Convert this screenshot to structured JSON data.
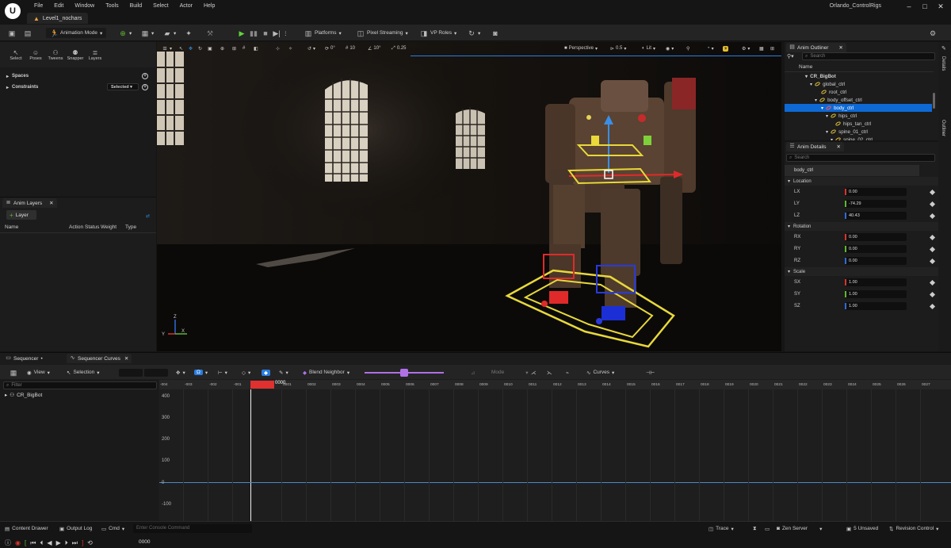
{
  "menu": [
    "File",
    "Edit",
    "Window",
    "Tools",
    "Build",
    "Select",
    "Actor",
    "Help"
  ],
  "level_tab": "Level1_nochars",
  "project_name": "Orlando_ControlRigs",
  "toolbar": {
    "mode": "Animation Mode",
    "platforms": "Platforms",
    "pixel_streaming": "Pixel Streaming",
    "vp_roles": "VP Roles"
  },
  "left_panel": {
    "modes": [
      "Select",
      "Poses",
      "Tweens",
      "Snapper",
      "Layers"
    ],
    "spaces": "Spaces",
    "constraints": "Constraints",
    "constraints_filter": "Selected"
  },
  "anim_layers": {
    "tab": "Anim Layers",
    "add_button": "Layer",
    "columns": [
      "Name",
      "Action",
      "Status",
      "Weight",
      "Type"
    ]
  },
  "viewport": {
    "perspective": "Perspective",
    "lit": "Lit",
    "transform_values": [
      "0°",
      "10",
      "10°",
      "0.25"
    ],
    "cam_speed": "0.5"
  },
  "outliner": {
    "tab": "Anim Outliner",
    "search_placeholder": "Search",
    "column": "Name",
    "items": [
      {
        "label": "CR_BigBot",
        "indent": 0,
        "selected": false
      },
      {
        "label": "global_ctrl",
        "indent": 1,
        "selected": false
      },
      {
        "label": "root_ctrl",
        "indent": 2,
        "selected": false
      },
      {
        "label": "body_offset_ctrl",
        "indent": 2,
        "selected": false
      },
      {
        "label": "body_ctrl",
        "indent": 3,
        "selected": true
      },
      {
        "label": "hips_ctrl",
        "indent": 4,
        "selected": false
      },
      {
        "label": "hips_tan_ctrl",
        "indent": 5,
        "selected": false
      },
      {
        "label": "spine_01_ctrl",
        "indent": 4,
        "selected": false
      },
      {
        "label": "spine_02_ctrl",
        "indent": 4,
        "selected": false
      }
    ]
  },
  "details": {
    "tab": "Anim Details",
    "search_placeholder": "Search",
    "selected_control": "body_ctrl",
    "sections": [
      {
        "name": "Location",
        "rows": [
          {
            "label": "LX",
            "value": "0.00",
            "color": "#d9342b"
          },
          {
            "label": "LY",
            "value": "-74.29",
            "color": "#5fb82f"
          },
          {
            "label": "LZ",
            "value": "40.43",
            "color": "#2f6bd9"
          }
        ]
      },
      {
        "name": "Rotation",
        "rows": [
          {
            "label": "RX",
            "value": "0.00",
            "color": "#d9342b"
          },
          {
            "label": "RY",
            "value": "0.00",
            "color": "#5fb82f"
          },
          {
            "label": "RZ",
            "value": "0.00",
            "color": "#2f6bd9"
          }
        ]
      },
      {
        "name": "Scale",
        "rows": [
          {
            "label": "SX",
            "value": "1.00",
            "color": "#d9342b"
          },
          {
            "label": "SY",
            "value": "1.00",
            "color": "#5fb82f"
          },
          {
            "label": "SZ",
            "value": "1.00",
            "color": "#2f6bd9"
          }
        ]
      }
    ]
  },
  "right_tabs": [
    "Details",
    "Outliner"
  ],
  "sequencer": {
    "tabs": [
      "Sequencer",
      "Sequencer Curves"
    ],
    "view": "View",
    "selection": "Selection",
    "blend": "Blend Neighbor",
    "mode": "Mode",
    "curves": "Curves",
    "filter_placeholder": "Filter",
    "track": "CR_BigBot",
    "current_frame": "0000",
    "frame_display": "0000",
    "ruler_labels": [
      "-004",
      "-003",
      "-002",
      "-001",
      "0000",
      "0001",
      "0002",
      "0003",
      "0004",
      "0005",
      "0006",
      "0007",
      "0008",
      "0009",
      "0010",
      "0011",
      "0012",
      "0013",
      "0014",
      "0015",
      "0016",
      "0017",
      "0018",
      "0019",
      "0020",
      "0021",
      "0022",
      "0023",
      "0024",
      "0025",
      "0026",
      "0027"
    ],
    "y_labels": [
      "400",
      "300",
      "200",
      "100",
      "0",
      "-100"
    ]
  },
  "statusbar": {
    "content_drawer": "Content Drawer",
    "output_log": "Output Log",
    "cmd": "Cmd",
    "console_placeholder": "Enter Console Command",
    "trace": "Trace",
    "zen_server": "Zen Server",
    "unsaved": "5 Unsaved",
    "revision_control": "Revision Control"
  }
}
